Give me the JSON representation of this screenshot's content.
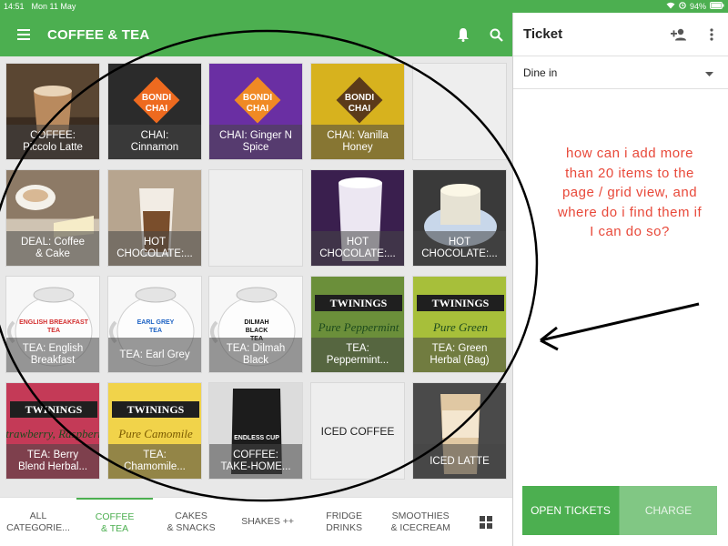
{
  "status_bar": {
    "time": "14:51",
    "date": "Mon 11 May",
    "battery": "94%"
  },
  "app_bar": {
    "title": "COFFEE & TEA",
    "icons": [
      "menu-icon",
      "bell-icon",
      "search-icon"
    ]
  },
  "grid": {
    "items": [
      {
        "label": "COFFEE:\nPiccolo Latte",
        "art": "coffee"
      },
      {
        "label": "CHAI:\nCinnamon",
        "art": "chai-orange"
      },
      {
        "label": "CHAI: Ginger N\nSpice",
        "art": "chai-purple"
      },
      {
        "label": "CHAI: Vanilla\nHoney",
        "art": "chai-yellow"
      },
      {
        "label": "",
        "art": "empty"
      },
      {
        "label": "DEAL: Coffee\n& Cake",
        "art": "cake"
      },
      {
        "label": "HOT\nCHOCOLATE:...",
        "art": "hot-choc"
      },
      {
        "label": "",
        "art": "empty"
      },
      {
        "label": "HOT\nCHOCOLATE:...",
        "art": "hot-choc-purple"
      },
      {
        "label": "HOT\nCHOCOLATE:...",
        "art": "hot-choc-cup"
      },
      {
        "label": "TEA: English\nBreakfast",
        "art": "teapot",
        "pot_text": "ENGLISH BREAKFAST\nTEA",
        "pot_color": "#d32f2f"
      },
      {
        "label": "TEA: Earl Grey",
        "art": "teapot",
        "pot_text": "EARL GREY\nTEA",
        "pot_color": "#1e63c4"
      },
      {
        "label": "TEA: Dilmah\nBlack",
        "art": "teapot",
        "pot_text": "DILMAH\nBLACK\nTEA",
        "pot_color": "#111111"
      },
      {
        "label": "TEA:\nPeppermint...",
        "art": "twinings-green",
        "brand": "TWININGS",
        "product": "Pure Peppermint"
      },
      {
        "label": "TEA: Green\nHerbal (Bag)",
        "art": "twinings-lime",
        "brand": "TWININGS",
        "product": "Pure Green Tea"
      },
      {
        "label": "TEA: Berry\nBlend Herbal...",
        "art": "twinings-red",
        "brand": "TWININGS",
        "product": "Strawberry, Raspberry & Loganberry"
      },
      {
        "label": "TEA:\nChamomile...",
        "art": "twinings-yellow",
        "brand": "TWININGS",
        "product": "Pure Camomile"
      },
      {
        "label": "COFFEE:\nTAKE-HOME...",
        "art": "coffee-bag",
        "brand": "ENDLESS CUP"
      },
      {
        "label": "ICED COFFEE",
        "art": "text-only"
      },
      {
        "label": "ICED LATTE",
        "art": "iced-latte"
      }
    ]
  },
  "tabs": [
    {
      "label": "ALL\nCATEGORIE...",
      "active": false
    },
    {
      "label": "COFFEE\n& TEA",
      "active": true
    },
    {
      "label": "CAKES\n& SNACKS",
      "active": false
    },
    {
      "label": "SHAKES ++",
      "active": false
    },
    {
      "label": "FRIDGE\nDRINKS",
      "active": false
    },
    {
      "label": "SMOOTHIES\n& ICECREAM",
      "active": false
    }
  ],
  "ticket": {
    "title": "Ticket",
    "dining_option": "Dine in",
    "open_tickets": "OPEN TICKETS",
    "charge": "CHARGE"
  },
  "annotation": {
    "text": "how can i add more than 20 items to the page / grid view, and where do i find them if I can do so?",
    "color": "#e8493a"
  },
  "colors": {
    "primary": "#4caf50",
    "charge_disabled": "#81c784"
  }
}
